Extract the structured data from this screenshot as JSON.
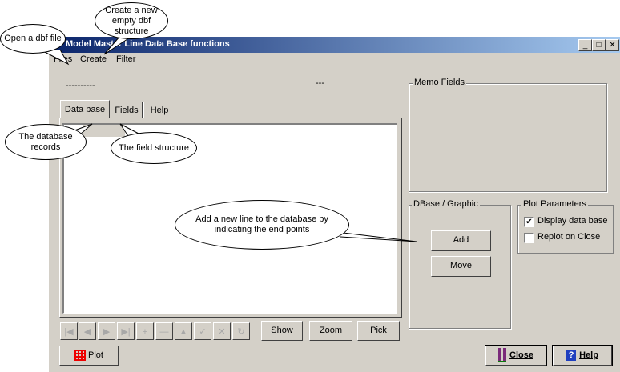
{
  "window": {
    "title": "Model Master Line Data Base functions"
  },
  "titlebar_buttons": {
    "minimize": "_",
    "maximize": "□",
    "close": "✕"
  },
  "menu": {
    "files": "Files",
    "create": "Create",
    "filter": "Filter"
  },
  "status": {
    "left": "----------",
    "center": "---"
  },
  "tabs": {
    "database": "Data base",
    "fields": "Fields",
    "help": "Help"
  },
  "nav_buttons": [
    "|◀",
    "◀",
    "▶",
    "▶|",
    "+",
    "—",
    "▲",
    "✓",
    "✕",
    "↻"
  ],
  "view_buttons": {
    "show": "Show",
    "zoom": "Zoom",
    "pick": "Pick"
  },
  "memo": {
    "label": "Memo Fields"
  },
  "dbase_graphic": {
    "label": "DBase / Graphic",
    "add": "Add",
    "move": "Move"
  },
  "plot_params": {
    "label": "Plot Parameters",
    "display_db": "Display data base",
    "display_db_checked": "✔",
    "replot": "Replot on Close"
  },
  "bottom": {
    "plot": "Plot",
    "close": "Close",
    "help": "Help"
  },
  "annotations": {
    "open_dbf": "Open a dbf file",
    "create_new": "Create a new empty dbf structure",
    "db_records": "The database records",
    "field_structure": "The field structure",
    "add_line": "Add a new line to the database by indicating the end points"
  }
}
